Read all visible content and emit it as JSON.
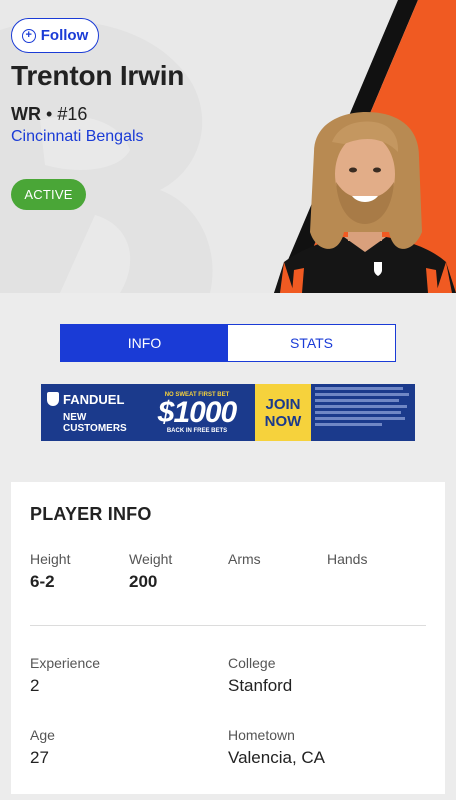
{
  "header": {
    "follow_label": "Follow",
    "player_name": "Trenton Irwin",
    "position": "WR",
    "separator": "•",
    "number": "#16",
    "team": "Cincinnati Bengals",
    "status": "ACTIVE"
  },
  "tabs": [
    {
      "label": "INFO",
      "active": true
    },
    {
      "label": "STATS",
      "active": false
    }
  ],
  "ad": {
    "brand": "FANDUEL",
    "sub": "NEW CUSTOMERS",
    "top": "NO SWEAT FIRST BET",
    "amount": "$1000",
    "bottom": "BACK IN FREE BETS",
    "cta_line1": "JOIN",
    "cta_line2": "NOW"
  },
  "player_info": {
    "title": "PLAYER INFO",
    "height_label": "Height",
    "height_value": "6-2",
    "weight_label": "Weight",
    "weight_value": "200",
    "arms_label": "Arms",
    "hands_label": "Hands",
    "experience_label": "Experience",
    "experience_value": "2",
    "college_label": "College",
    "college_value": "Stanford",
    "age_label": "Age",
    "age_value": "27",
    "hometown_label": "Hometown",
    "hometown_value": "Valencia, CA"
  },
  "colors": {
    "accent": "#1a3bd6",
    "active_green": "#4aa637",
    "bengals_orange": "#f05a22",
    "bengals_black": "#111111"
  }
}
